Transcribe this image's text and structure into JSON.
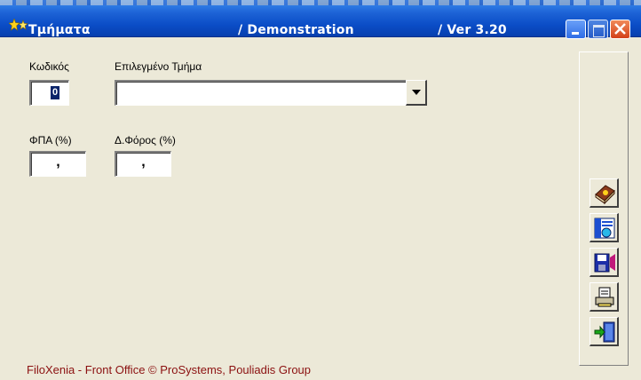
{
  "window": {
    "app_title": "Τμήματα",
    "center_title": "/ Demonstration",
    "version": "/ Ver  3.20"
  },
  "form": {
    "code_label": "Κωδικός",
    "code_value": "0",
    "dept_label": "Επιλεγμένο Τμήμα",
    "dept_value": "",
    "vat_label": "ΦΠΑ (%)",
    "vat_value": ",",
    "tax_label": "Δ.Φόρος (%)",
    "tax_value": ","
  },
  "toolbar": {
    "icons": [
      "help-book-icon",
      "list-settings-icon",
      "save-disk-icon",
      "print-icon",
      "exit-door-icon"
    ]
  },
  "footer": {
    "text": "FiloXenia - Front Office  © ProSystems,   Pouliadis Group"
  }
}
